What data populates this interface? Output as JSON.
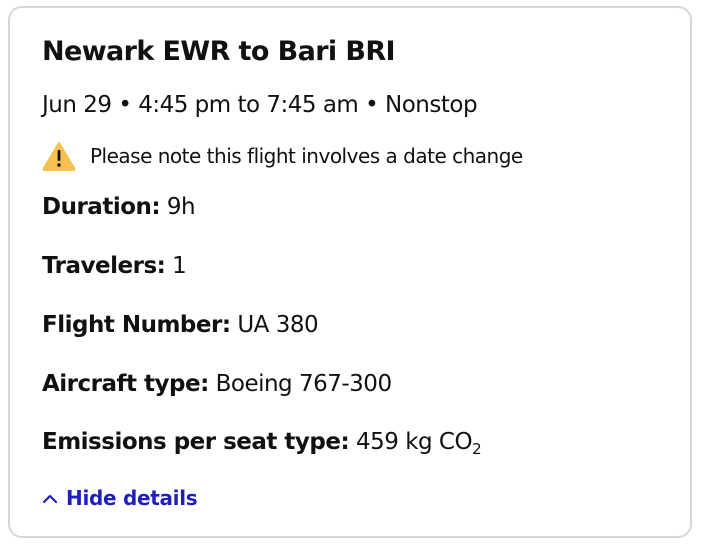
{
  "flight": {
    "title": "Newark EWR to Bari BRI",
    "subtitle": "Jun 29 • 4:45 pm to 7:45 am • Nonstop",
    "warning": "Please note this flight involves a date change",
    "details": {
      "duration_label": "Duration:",
      "duration_value": "9h",
      "travelers_label": "Travelers:",
      "travelers_value": "1",
      "flight_number_label": "Flight Number:",
      "flight_number_value": "UA 380",
      "aircraft_label": "Aircraft type:",
      "aircraft_value": "Boeing 767-300",
      "emissions_label": "Emissions per seat type:",
      "emissions_value": "459 kg CO",
      "emissions_subscript": "2"
    },
    "toggle_label": "Hide details"
  },
  "icons": {
    "warning": "warning-triangle-icon",
    "toggle": "chevron-up-icon"
  },
  "colors": {
    "link": "#1f1fbf",
    "warning_fill": "#f5c04e",
    "border": "#d6d6d6"
  }
}
